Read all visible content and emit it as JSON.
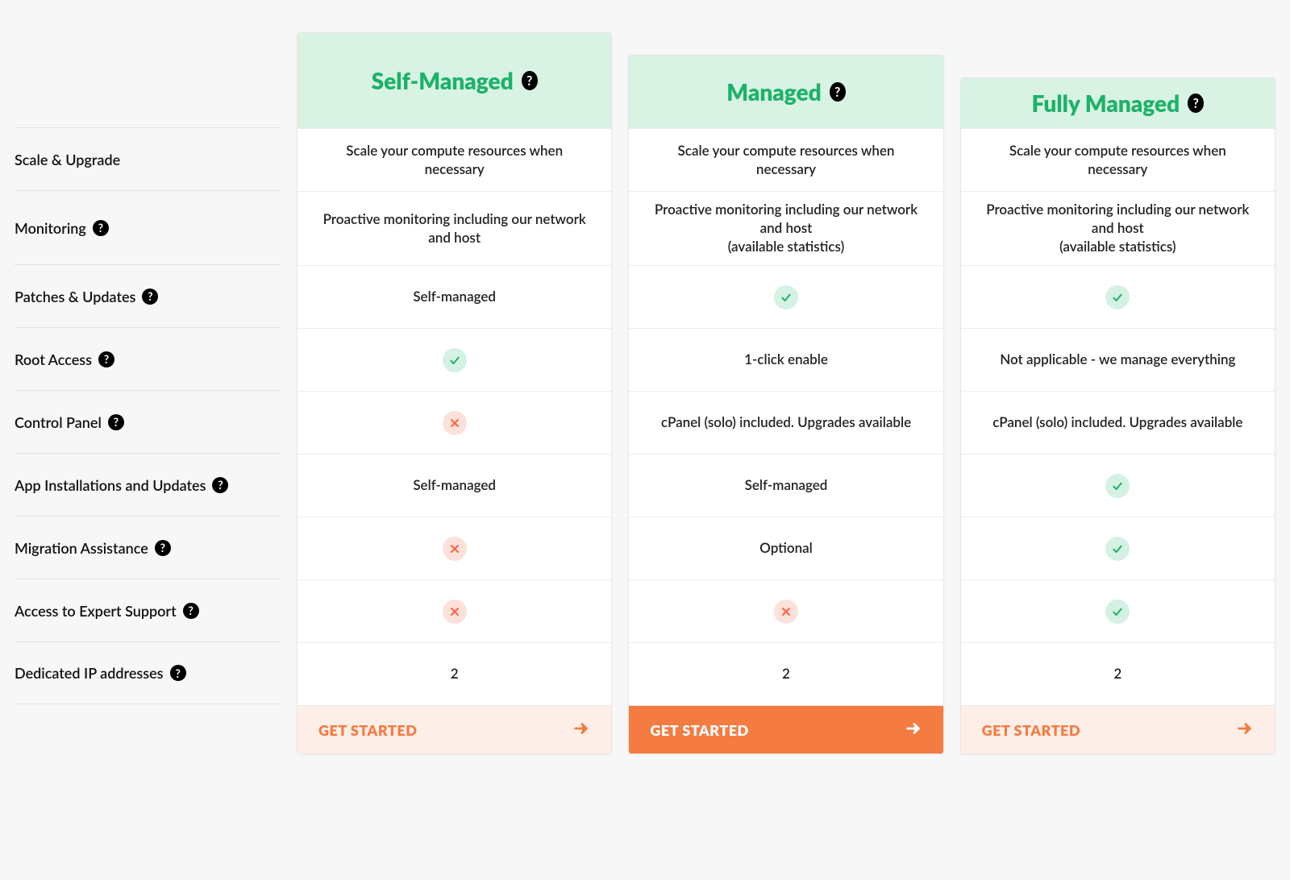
{
  "features": [
    {
      "label": "Scale & Upgrade",
      "help": false,
      "tall": false
    },
    {
      "label": "Monitoring",
      "help": true,
      "tall": true
    },
    {
      "label": "Patches & Updates",
      "help": true,
      "tall": false
    },
    {
      "label": "Root Access",
      "help": true,
      "tall": false
    },
    {
      "label": "Control Panel",
      "help": true,
      "tall": false
    },
    {
      "label": "App Installations and Updates",
      "help": true,
      "tall": false
    },
    {
      "label": "Migration Assistance",
      "help": true,
      "tall": false
    },
    {
      "label": "Access to Expert Support",
      "help": true,
      "tall": false
    },
    {
      "label": "Dedicated IP addresses",
      "help": true,
      "tall": false
    }
  ],
  "plans": [
    {
      "name": "Self-Managed",
      "stair": 0,
      "cta_style": "light",
      "cta_label": "GET STARTED",
      "rows": [
        {
          "type": "text",
          "text": "Scale your compute resources when necessary"
        },
        {
          "type": "text",
          "text": "Proactive monitoring including our network and host"
        },
        {
          "type": "text",
          "text": "Self-managed"
        },
        {
          "type": "check"
        },
        {
          "type": "cross"
        },
        {
          "type": "text",
          "text": "Self-managed"
        },
        {
          "type": "cross"
        },
        {
          "type": "cross"
        },
        {
          "type": "text",
          "text": "2"
        }
      ]
    },
    {
      "name": "Managed",
      "stair": 1,
      "cta_style": "solid",
      "cta_label": "GET STARTED",
      "rows": [
        {
          "type": "text",
          "text": "Scale your compute resources when necessary"
        },
        {
          "type": "text",
          "text": "Proactive monitoring including our network and host\n(available statistics)"
        },
        {
          "type": "check"
        },
        {
          "type": "text",
          "text": "1-click enable"
        },
        {
          "type": "text",
          "text": "cPanel (solo) included. Upgrades available"
        },
        {
          "type": "text",
          "text": "Self-managed"
        },
        {
          "type": "text",
          "text": "Optional"
        },
        {
          "type": "cross"
        },
        {
          "type": "text",
          "text": "2"
        }
      ]
    },
    {
      "name": "Fully Managed",
      "stair": 2,
      "cta_style": "light",
      "cta_label": "GET STARTED",
      "rows": [
        {
          "type": "text",
          "text": "Scale your compute resources when necessary"
        },
        {
          "type": "text",
          "text": "Proactive monitoring including our network and host\n(available statistics)"
        },
        {
          "type": "check"
        },
        {
          "type": "text",
          "text": "Not applicable - we manage everything"
        },
        {
          "type": "text",
          "text": "cPanel (solo) included. Upgrades available"
        },
        {
          "type": "check"
        },
        {
          "type": "check"
        },
        {
          "type": "check"
        },
        {
          "type": "text",
          "text": "2"
        }
      ]
    }
  ]
}
